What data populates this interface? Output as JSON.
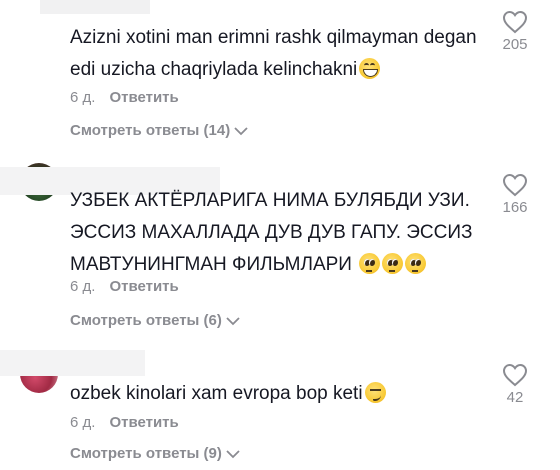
{
  "comments": [
    {
      "text": "Azizni xotini man erimni rashk qilmayman degan edi uzicha chaqriylada kelinchakni",
      "emoji": [
        "grinning-face-emoji"
      ],
      "time": "6 д.",
      "reply_label": "Ответить",
      "view_replies": "Смотреть ответы (14)",
      "likes": "205"
    },
    {
      "text": "УЗБЕК АКТЁРЛАРИГА НИМА БУЛЯБДИ УЗИ. ЭССИЗ МАХАЛЛАДА ДУВ ДУВ ГАПУ. ЭССИЗ МАВТУНИНГМАН ФИЛЬМЛАРИ",
      "emoji": [
        "pleading-face-emoji",
        "pleading-face-emoji",
        "pleading-face-emoji"
      ],
      "time": "6 д.",
      "reply_label": "Ответить",
      "view_replies": "Смотреть ответы (6)",
      "likes": "166"
    },
    {
      "text": "ozbek kinolari xam evropa bop keti",
      "emoji": [
        "smirking-face-emoji"
      ],
      "time": "6 д.",
      "reply_label": "Ответить",
      "view_replies": "Смотреть ответы (9)",
      "likes": "42"
    }
  ],
  "colors": {
    "text": "#161823",
    "muted": "#8a8b91",
    "background": "#ffffff"
  }
}
